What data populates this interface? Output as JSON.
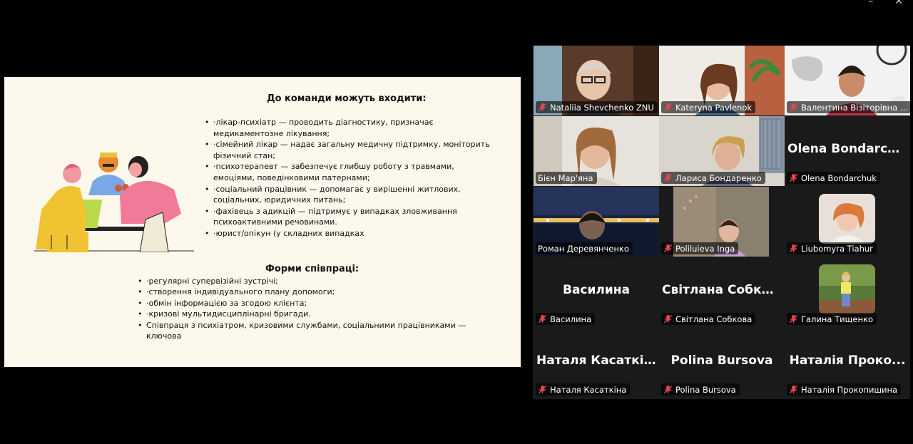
{
  "window_controls": {
    "minimize": "–",
    "close": "✕"
  },
  "slide": {
    "heading1": "До команди можуть входити:",
    "list1": [
      "·лікар-психіатр — проводить діагностику, призначає медикаментозне лікування;",
      "·сімейний лікар — надає загальну медичну підтримку, моніторить фізичний стан;",
      "·психотерапевт — забезпечує глибшу роботу з травмами, емоціями, поведінковими патернами;",
      "·соціальний працівник — допомагає у вирішенні житлових, соціальних, юридичних питань;",
      "·фахівець з адикцій — підтримує у випадках зловживання психоактивними речовинами.",
      "·юрист/опікун (у складних випадках"
    ],
    "heading2": "Форми співпраці:",
    "list2": [
      "·регулярні супервізійні зустрічі;",
      "·створення індивідуального плану допомоги;",
      "·обмін інформацією за згодою клієнта;",
      "·кризові мультидисциплінарні бригади.",
      "Співпраця з психіатром, кризовими службами, соціальними працівниками — ключова"
    ]
  },
  "participants": {
    "p1": {
      "name": "Nataliia Shevchenko ZNU",
      "muted": true
    },
    "p2": {
      "name": "Kateryna Pavlenok",
      "muted": true
    },
    "p3": {
      "name": "Валентина Візіторівна Б...",
      "muted": true
    },
    "p4": {
      "name": "Бієн Мар'яна",
      "muted": false,
      "active_speaker": true
    },
    "p5": {
      "name": "Лариса Бондаренко",
      "muted": true
    },
    "p6": {
      "name": "Olena Bondarchuk",
      "display": "Olena  Bondarch...",
      "muted": true
    },
    "p7": {
      "name": "Роман Деревянченко",
      "muted": false
    },
    "p8": {
      "name": "Poliluieva Inga",
      "muted": true
    },
    "p9": {
      "name": "Liubomyra Tiahur",
      "muted": true
    },
    "p10": {
      "name": "Василина",
      "display": "Василина",
      "muted": true
    },
    "p11": {
      "name": "Світлана Собкова",
      "display": "Світлана  Собко...",
      "muted": true
    },
    "p12": {
      "name": "Галина Тищенко",
      "muted": true
    },
    "p13": {
      "name": "Наталя  Касаткіна",
      "display": "Наталя   Касаткі...",
      "muted": true
    },
    "p14": {
      "name": "Polina Bursova",
      "display": "Polina Bursova",
      "muted": true
    },
    "p15": {
      "name": "Наталія Прокопишина",
      "display": "Наталія  Проко...",
      "muted": true
    }
  },
  "colors": {
    "active_border": "#23d959",
    "muted_mic": "#e5484d",
    "slide_bg": "#fcf8ec"
  }
}
